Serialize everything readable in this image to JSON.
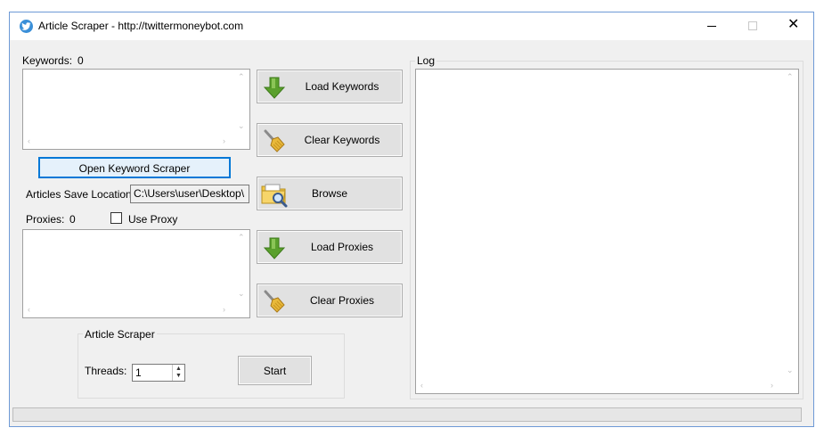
{
  "window": {
    "title": "Article Scraper - http://twittermoneybot.com"
  },
  "keywords": {
    "label": "Keywords:",
    "count": "0"
  },
  "buttons": {
    "load_keywords": "Load Keywords",
    "clear_keywords": "Clear Keywords",
    "browse": "Browse",
    "load_proxies": "Load Proxies",
    "clear_proxies": "Clear Proxies",
    "open_keyword_scraper": "Open Keyword Scraper",
    "start": "Start"
  },
  "save_location": {
    "label": "Articles Save Location:",
    "value": "C:\\Users\\user\\Desktop\\"
  },
  "proxies": {
    "label": "Proxies:",
    "count": "0",
    "use_proxy_label": "Use Proxy",
    "use_proxy_checked": false
  },
  "scraper_group": {
    "title": "Article Scraper",
    "threads_label": "Threads:",
    "threads_value": "1"
  },
  "log": {
    "title": "Log"
  },
  "icons": {
    "app": "twitter-bird-icon",
    "load": "green-down-arrow-icon",
    "clear": "broom-icon",
    "browse": "folder-search-icon"
  },
  "colors": {
    "focus_border": "#0078d7",
    "arrow_green": "#5aa02c",
    "app_icon_blue": "#3a8fd8"
  }
}
